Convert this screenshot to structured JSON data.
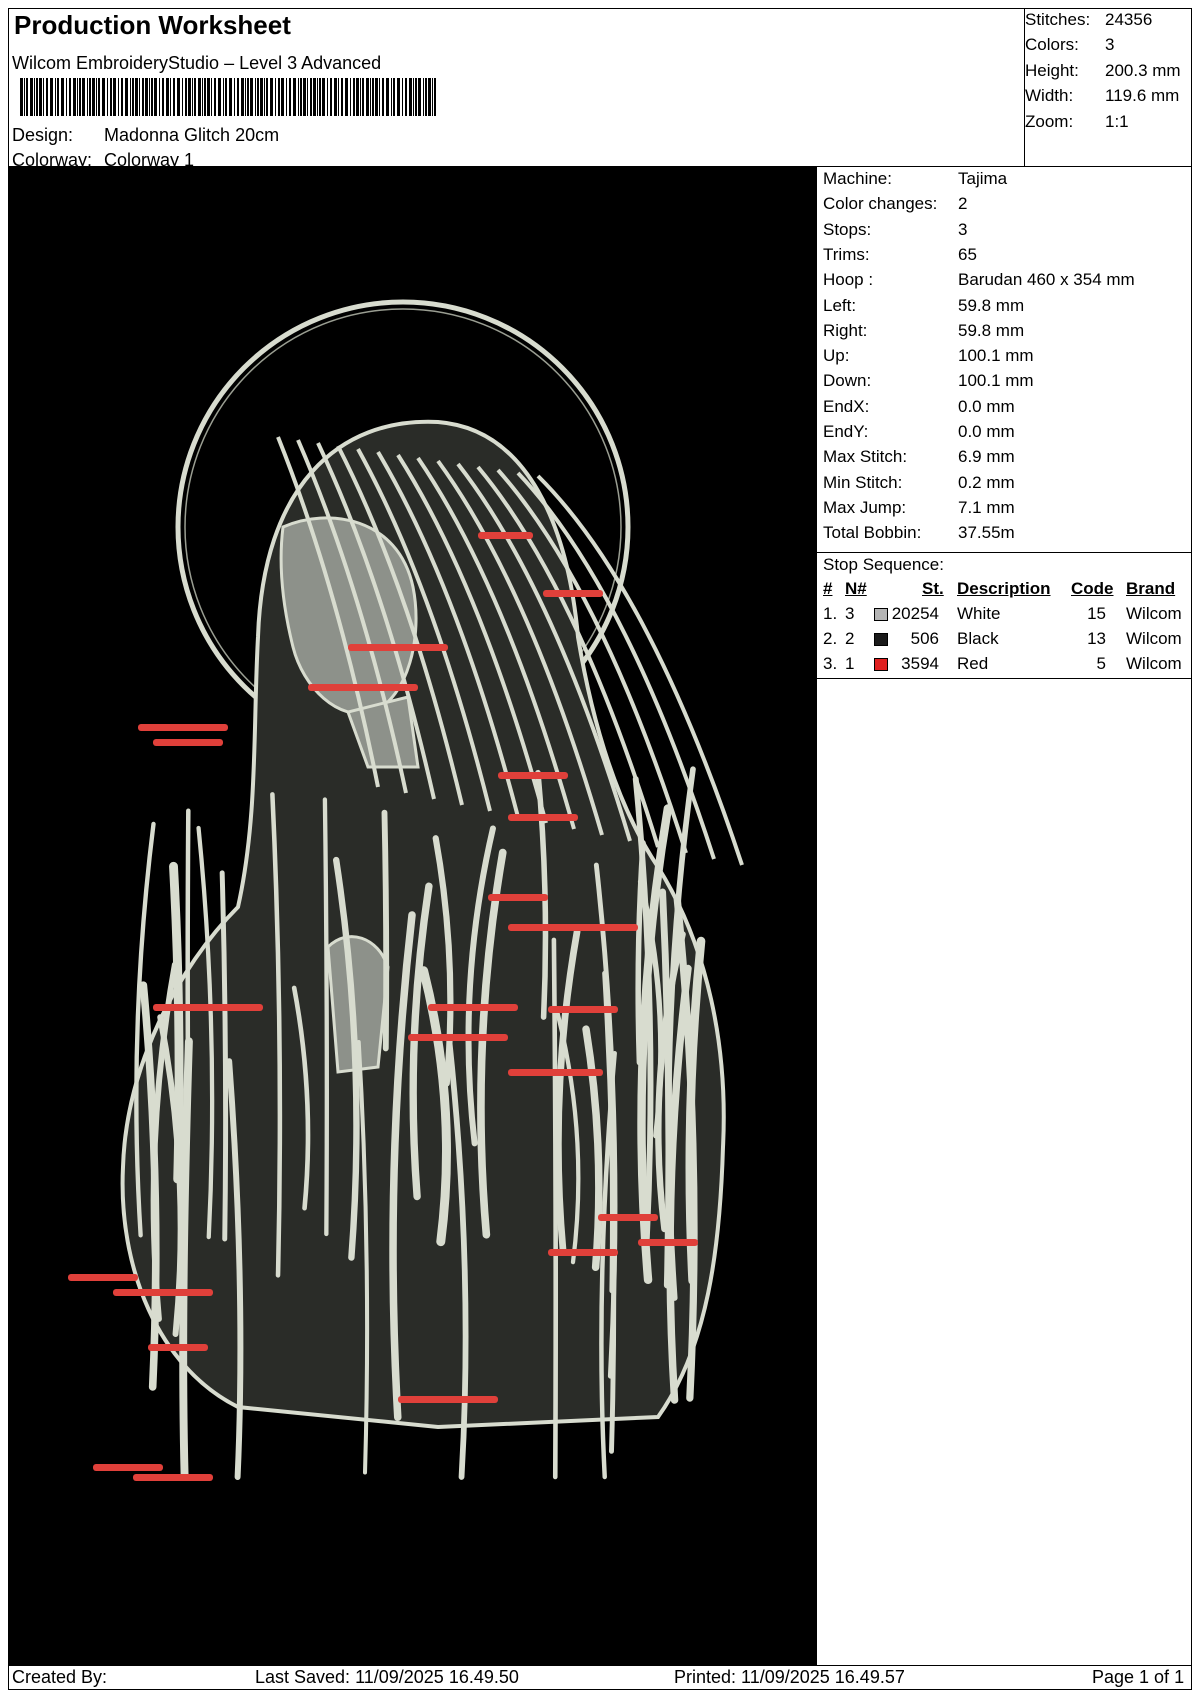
{
  "header": {
    "title": "Production Worksheet",
    "subtitle": "Wilcom EmbroideryStudio – Level 3 Advanced",
    "design_label": "Design:",
    "design_value": "Madonna Glitch 20cm",
    "colorway_label": "Colorway:",
    "colorway_value": "Colorway 1"
  },
  "header_stats": [
    {
      "label": "Stitches:",
      "value": "24356"
    },
    {
      "label": "Colors:",
      "value": "3"
    },
    {
      "label": "Height:",
      "value": "200.3 mm"
    },
    {
      "label": "Width:",
      "value": "119.6 mm"
    },
    {
      "label": "Zoom:",
      "value": "1:1"
    }
  ],
  "machine_info": [
    {
      "label": "Machine:",
      "value": "Tajima"
    },
    {
      "label": "Color changes:",
      "value": "2"
    },
    {
      "label": "Stops:",
      "value": "3"
    },
    {
      "label": "Trims:",
      "value": "65"
    },
    {
      "label": "Hoop :",
      "value": "Barudan 460 x 354 mm"
    },
    {
      "label": "Left:",
      "value": "59.8 mm"
    },
    {
      "label": "Right:",
      "value": "59.8 mm"
    },
    {
      "label": "Up:",
      "value": "100.1 mm"
    },
    {
      "label": "Down:",
      "value": "100.1 mm"
    },
    {
      "label": "EndX:",
      "value": "0.0 mm"
    },
    {
      "label": "EndY:",
      "value": "0.0 mm"
    },
    {
      "label": "Max Stitch:",
      "value": "6.9 mm"
    },
    {
      "label": "Min Stitch:",
      "value": "0.2 mm"
    },
    {
      "label": "Max Jump:",
      "value": "7.1 mm"
    },
    {
      "label": "Total Bobbin:",
      "value": "37.55m"
    }
  ],
  "stop_sequence": {
    "label": "Stop Sequence:",
    "headers": {
      "num": "#",
      "n": "N#",
      "st": "St.",
      "desc": "Description",
      "code": "Code",
      "brand": "Brand"
    },
    "rows": [
      {
        "num": "1.",
        "n": "3",
        "color": "#b4b4b4",
        "st": "20254",
        "desc": "White",
        "code": "15",
        "brand": "Wilcom"
      },
      {
        "num": "2.",
        "n": "2",
        "color": "#1a1a1a",
        "st": "506",
        "desc": "Black",
        "code": "13",
        "brand": "Wilcom"
      },
      {
        "num": "3.",
        "n": "1",
        "color": "#e02020",
        "st": "3594",
        "desc": "Red",
        "code": "5",
        "brand": "Wilcom"
      }
    ]
  },
  "footer": {
    "created_by": "Created By:",
    "last_saved": "Last Saved: 11/09/2025 16.49.50",
    "printed": "Printed: 11/09/2025 16.49.57",
    "page": "Page 1 of 1"
  },
  "design_colors": {
    "background": "#000000",
    "thread_light": "#d8dccf",
    "thread_shade": "#9a9e92",
    "thread_red": "#e0403a"
  }
}
